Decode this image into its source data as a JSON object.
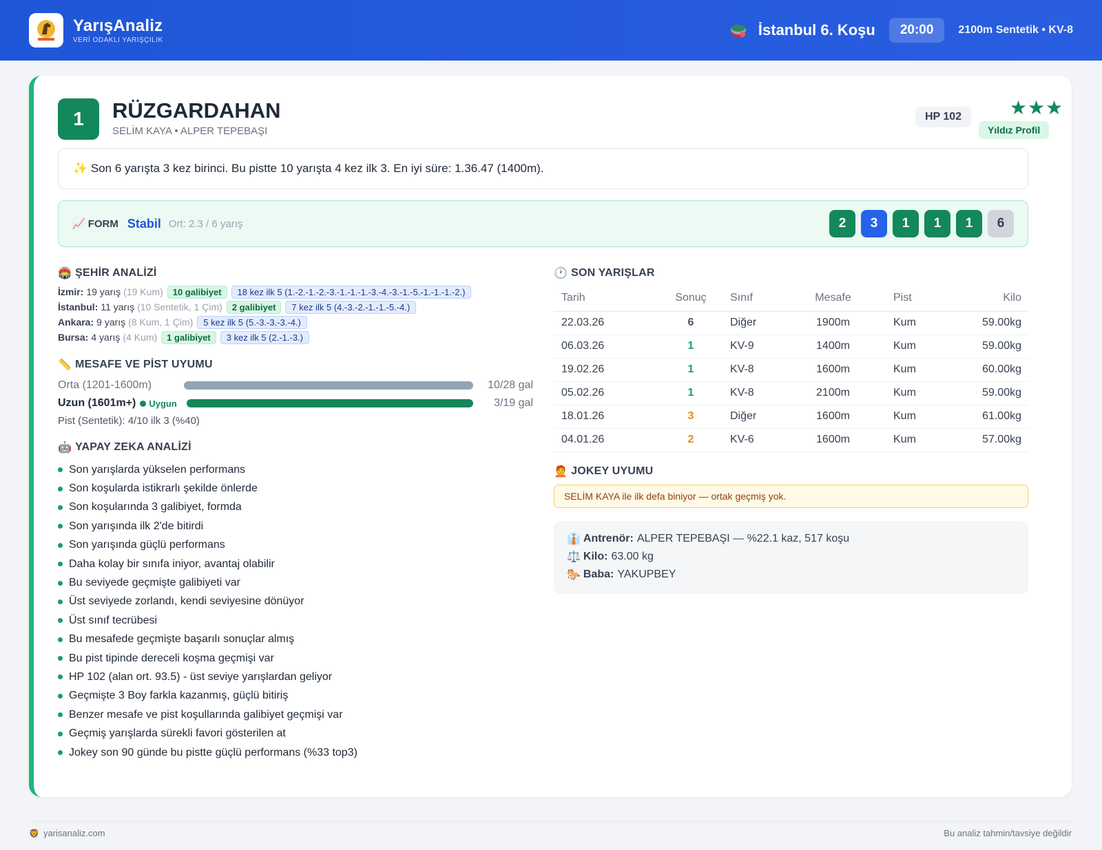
{
  "header": {
    "brand": "YarışAnaliz",
    "tagline": "VERİ ODAKLI YARIŞÇILIK",
    "race_title": "İstanbul 6. Koşu",
    "time": "20:00",
    "race_info": "2100m Sentetik • KV-8"
  },
  "horse": {
    "number": "1",
    "name": "RÜZGARDAHAN",
    "people": "SELİM KAYA • ALPER TEPEBAŞI",
    "hp": "HP 102",
    "stars": "★★★",
    "star_badge": "Yıldız Profil",
    "summary": "✨ Son 6 yarışta 3 kez birinci. Bu pistte 10 yarışta 4 kez ilk 3. En iyi süre: 1.36.47 (1400m)."
  },
  "form": {
    "label": "FORM",
    "state": "Stabil",
    "avg": "Ort: 2.3 / 6 yarış",
    "chips": [
      {
        "value": "2",
        "color": "#13885a"
      },
      {
        "value": "3",
        "color": "#2563eb"
      },
      {
        "value": "1",
        "color": "#13885a"
      },
      {
        "value": "1",
        "color": "#13885a"
      },
      {
        "value": "1",
        "color": "#13885a"
      },
      {
        "value": "6",
        "color": "#d1d5db"
      }
    ]
  },
  "city": {
    "title": "ŞEHİR ANALİZİ",
    "rows": [
      {
        "city": "İzmir:",
        "races": "19 yarış",
        "detail": "(19 Kum)",
        "wins": "10 galibiyet",
        "top5": "18 kez ilk 5 (1.-2.-1.-2.-3.-1.-1.-1.-3.-4.-3.-1.-5.-1.-1.-1.-2.)"
      },
      {
        "city": "İstanbul:",
        "races": "11 yarış",
        "detail": "(10 Sentetik, 1 Çim)",
        "wins": "2 galibiyet",
        "top5": "7 kez ilk 5 (4.-3.-2.-1.-1.-5.-4.)"
      },
      {
        "city": "Ankara:",
        "races": "9 yarış",
        "detail": "(8 Kum, 1 Çim)",
        "wins": "",
        "top5": "5 kez ilk 5 (5.-3.-3.-3.-4.)"
      },
      {
        "city": "Bursa:",
        "races": "4 yarış",
        "detail": "(4 Kum)",
        "wins": "1 galibiyet",
        "top5": "3 kez ilk 5 (2.-1.-3.)"
      }
    ]
  },
  "distance": {
    "title": "MESAFE VE PİST UYUMU",
    "rows": [
      {
        "label": "Orta (1201-1600m)",
        "value": "10/28 gal",
        "fill": 1.0,
        "color": "#94a3b8",
        "badge": ""
      },
      {
        "label": "Uzun (1601m+)",
        "value": "3/19 gal",
        "fill": 1.0,
        "color": "#13885a",
        "badge": "Uygun"
      }
    ],
    "track_note": "Pist (Sentetik): 4/10 ilk 3 (%40)"
  },
  "ai": {
    "title": "YAPAY ZEKA ANALİZİ",
    "items": [
      "Son yarışlarda yükselen performans",
      "Son koşularda istikrarlı şekilde önlerde",
      "Son koşularında 3 galibiyet, formda",
      "Son yarışında ilk 2'de bitirdi",
      "Son yarışında güçlü performans",
      "Daha kolay bir sınıfa iniyor, avantaj olabilir",
      "Bu seviyede geçmişte galibiyeti var",
      "Üst seviyede zorlandı, kendi seviyesine dönüyor",
      "Üst sınıf tecrübesi",
      "Bu mesafede geçmişte başarılı sonuçlar almış",
      "Bu pist tipinde dereceli koşma geçmişi var",
      "HP 102 (alan ort. 93.5) - üst seviye yarışlardan geliyor",
      "Geçmişte 3 Boy farkla kazanmış, güçlü bitiriş",
      "Benzer mesafe ve pist koşullarında galibiyet geçmişi var",
      "Geçmiş yarışlarda sürekli favori gösterilen at",
      "Jokey son 90 günde bu pistte güçlü performans (%33 top3)"
    ]
  },
  "races": {
    "title": "SON YARIŞLAR",
    "headers": [
      "Tarih",
      "Sonuç",
      "Sınıf",
      "Mesafe",
      "Pist",
      "Kilo"
    ],
    "rows": [
      {
        "date": "22.03.26",
        "result": "6",
        "rcolor": "#475569",
        "class": "Diğer",
        "dist": "1900m",
        "track": "Kum",
        "kg": "59.00kg"
      },
      {
        "date": "06.03.26",
        "result": "1",
        "rcolor": "#13a06a",
        "class": "KV-9",
        "dist": "1400m",
        "track": "Kum",
        "kg": "59.00kg"
      },
      {
        "date": "19.02.26",
        "result": "1",
        "rcolor": "#13a06a",
        "class": "KV-8",
        "dist": "1600m",
        "track": "Kum",
        "kg": "60.00kg"
      },
      {
        "date": "05.02.26",
        "result": "1",
        "rcolor": "#13a06a",
        "class": "KV-8",
        "dist": "2100m",
        "track": "Kum",
        "kg": "59.00kg"
      },
      {
        "date": "18.01.26",
        "result": "3",
        "rcolor": "#e58a1f",
        "class": "Diğer",
        "dist": "1600m",
        "track": "Kum",
        "kg": "61.00kg"
      },
      {
        "date": "04.01.26",
        "result": "2",
        "rcolor": "#e58a1f",
        "class": "KV-6",
        "dist": "1600m",
        "track": "Kum",
        "kg": "57.00kg"
      }
    ]
  },
  "jokey": {
    "title": "JOKEY UYUMU",
    "alert": "SELİM KAYA ile ilk defa biniyor — ortak geçmiş yok."
  },
  "info": {
    "trainer_label": "Antrenör:",
    "trainer_value": "ALPER TEPEBAŞI — %22.1 kaz, 517 koşu",
    "kilo_label": "Kilo:",
    "kilo_value": "63.00 kg",
    "sire_label": "Baba:",
    "sire_value": "YAKUPBEY"
  },
  "footer": {
    "site": "yarisanaliz.com",
    "disclaimer": "Bu analiz tahmin/tavsiye değildir"
  }
}
